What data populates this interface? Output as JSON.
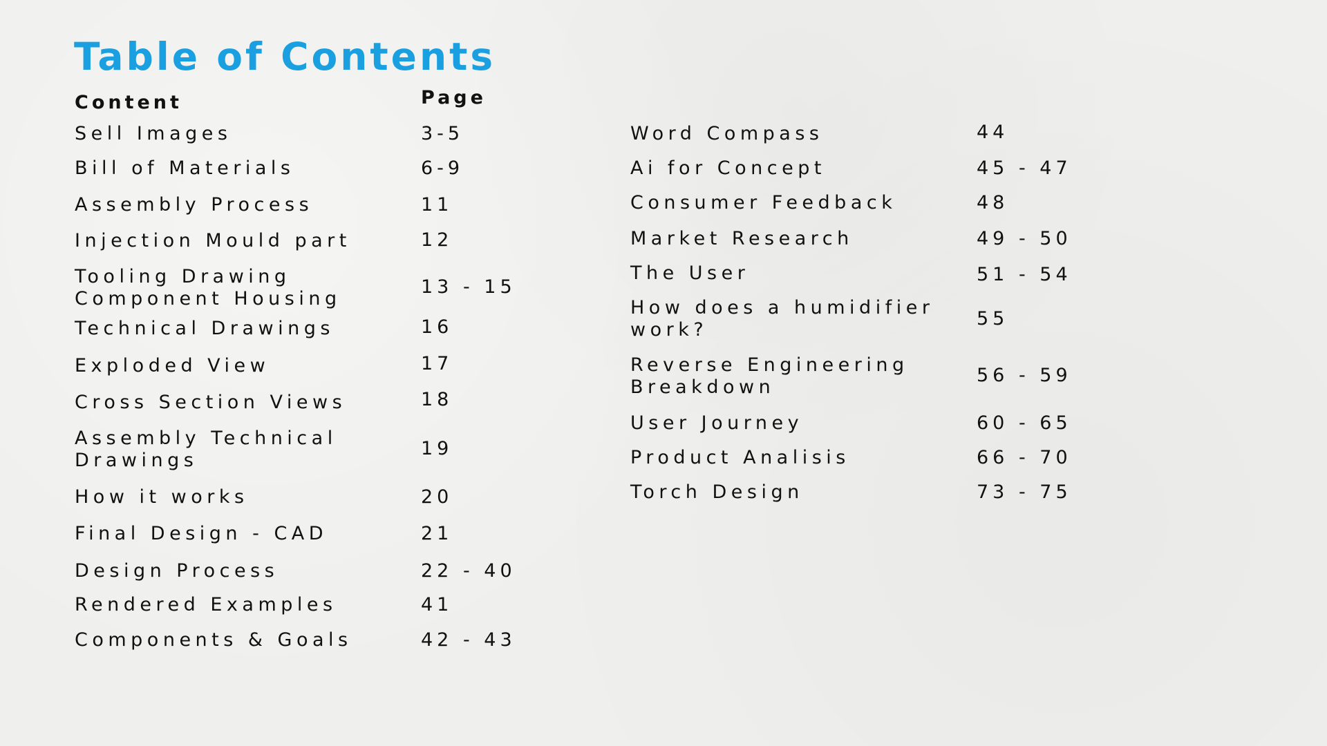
{
  "title": "Table of Contents",
  "headers": {
    "content": "Content",
    "page": "Page"
  },
  "left_entries": [
    {
      "content": "Sell Images",
      "page": "3-5"
    },
    {
      "content": "Bill of Materials",
      "page": "6-9"
    },
    {
      "content": "Assembly Process",
      "page": "11"
    },
    {
      "content": "Injection Mould part",
      "page": "12"
    },
    {
      "content": "Tooling Drawing\nComponent Housing",
      "page": "13 - 15"
    },
    {
      "content": "Technical Drawings",
      "page": "16"
    },
    {
      "content": "Exploded View",
      "page": "17"
    },
    {
      "content": "Cross Section Views",
      "page": "18"
    },
    {
      "content": "Assembly Technical\nDrawings",
      "page": "19"
    },
    {
      "content": "How it works",
      "page": "20"
    },
    {
      "content": "Final Design - CAD",
      "page": "21"
    },
    {
      "content": "Design Process",
      "page": "22 - 40"
    },
    {
      "content": "Rendered Examples",
      "page": "41"
    },
    {
      "content": "Components & Goals",
      "page": "42 - 43"
    }
  ],
  "right_entries": [
    {
      "content": "Word Compass",
      "page": "44"
    },
    {
      "content": "Ai for Concept",
      "page": "45 - 47"
    },
    {
      "content": "Consumer Feedback",
      "page": "48"
    },
    {
      "content": "Market Research",
      "page": "49 - 50"
    },
    {
      "content": "The User",
      "page": "51 - 54"
    },
    {
      "content": "How does a humidifier\nwork?",
      "page": "55"
    },
    {
      "content": "Reverse Engineering\nBreakdown",
      "page": "56 - 59"
    },
    {
      "content": "User Journey",
      "page": "60 - 65"
    },
    {
      "content": "Product Analisis",
      "page": "66 - 70"
    },
    {
      "content": "Torch Design",
      "page": "73 - 75"
    }
  ]
}
